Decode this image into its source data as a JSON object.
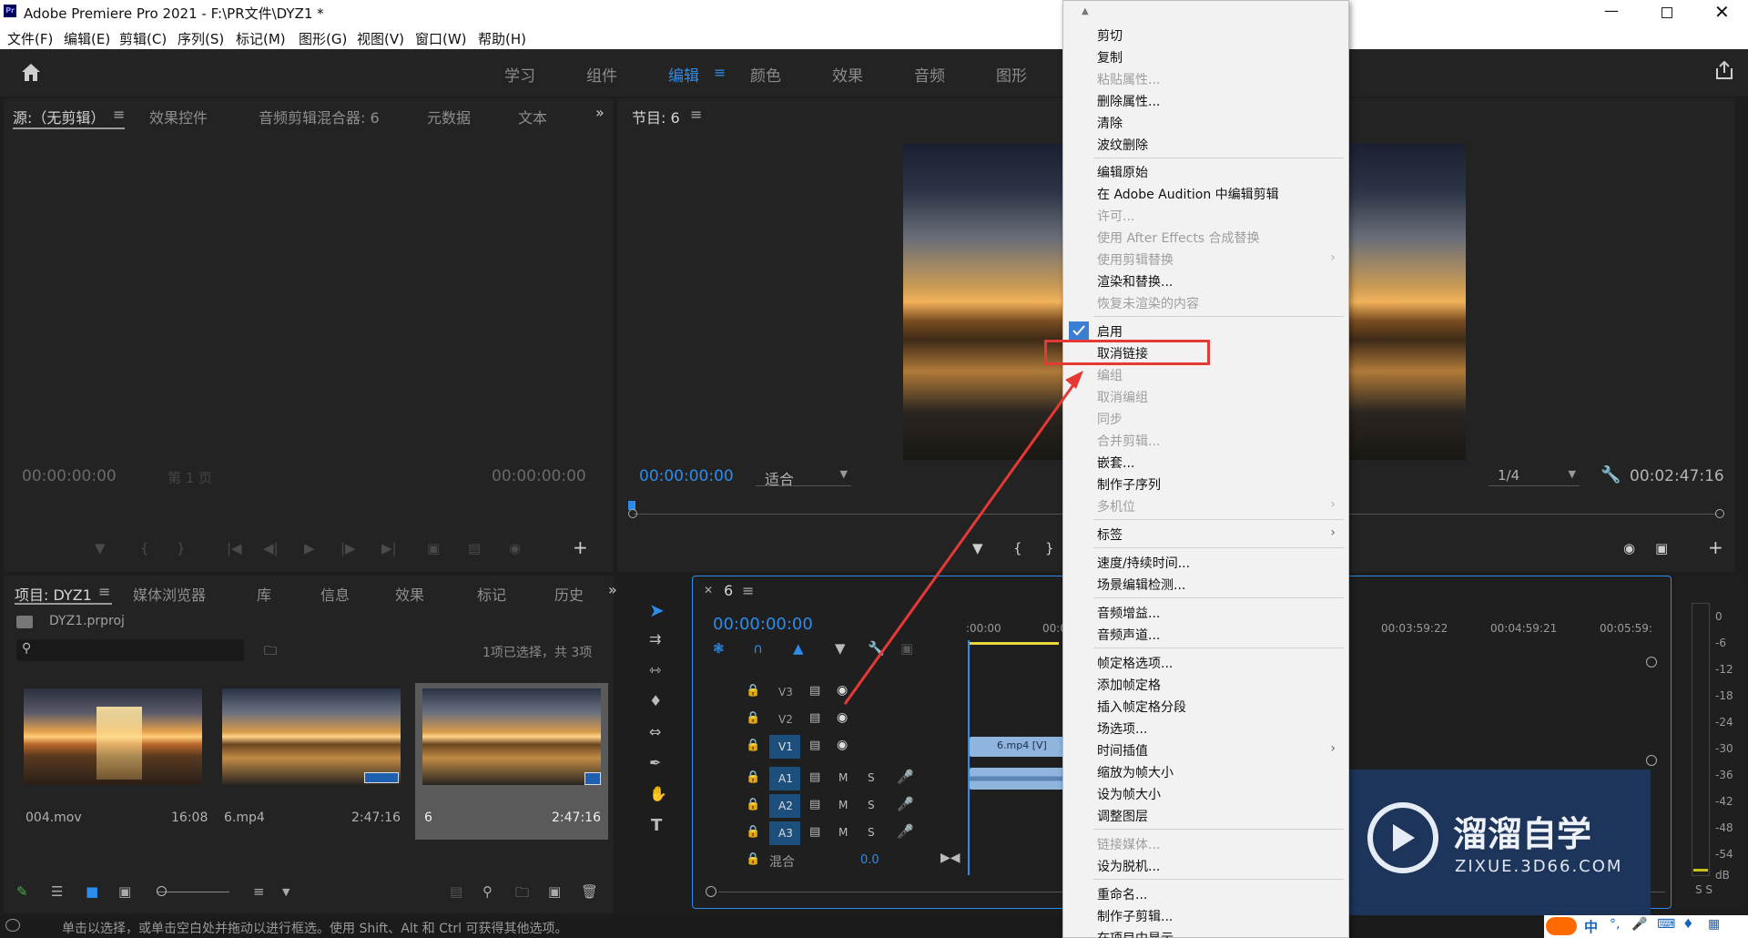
{
  "app": {
    "title": "Adobe Premiere Pro 2021 - F:\\PR文件\\DYZ1 *",
    "logo": "Pr"
  },
  "menubar": [
    "文件(F)",
    "编辑(E)",
    "剪辑(C)",
    "序列(S)",
    "标记(M)",
    "图形(G)",
    "视图(V)",
    "窗口(W)",
    "帮助(H)"
  ],
  "workspaces": [
    "学习",
    "组件",
    "编辑",
    "颜色",
    "效果",
    "音频",
    "图形"
  ],
  "source_panel": {
    "tabs": [
      "源:（无剪辑）",
      "效果控件",
      "音频剪辑混合器: 6",
      "元数据",
      "文本"
    ],
    "timecode_in": "00:00:00:00",
    "timecode_out": "00:00:00:00",
    "page": "第 1 页"
  },
  "program_panel": {
    "tab": "节目: 6",
    "timecode": "00:00:00:00",
    "fit": "适合",
    "resolution": "1/4",
    "duration": "00:02:47:16"
  },
  "project_panel": {
    "tabs": [
      "项目: DYZ1",
      "媒体浏览器",
      "库",
      "信息",
      "效果",
      "标记",
      "历史"
    ],
    "project_file": "DYZ1.prproj",
    "selection_info": "1项已选择，共 3项",
    "search_placeholder": "",
    "clips": [
      {
        "name": "004.mov",
        "duration": "16:08"
      },
      {
        "name": "6.mp4",
        "duration": "2:47:16"
      },
      {
        "name": "6",
        "duration": "2:47:16"
      }
    ]
  },
  "timeline": {
    "sequence": "6",
    "timecode": "00:00:00:00",
    "ruler": [
      ":00:00",
      "00:0",
      "00:03:59:22",
      "00:04:59:21",
      "00:05:59:"
    ],
    "tracks": [
      "V3",
      "V2",
      "V1",
      "A1",
      "A2",
      "A3"
    ],
    "mix_label": "混合",
    "mix_value": "0.0",
    "clip_video_label": "6.mp4 [V]"
  },
  "meter": {
    "scale": [
      "0",
      "-6",
      "-12",
      "-18",
      "-24",
      "-30",
      "-36",
      "-42",
      "-48",
      "-54",
      "dB"
    ],
    "solo": "S S"
  },
  "context_menu": {
    "items": [
      {
        "label": "剪切",
        "disabled": false
      },
      {
        "label": "复制",
        "disabled": false
      },
      {
        "label": "粘贴属性...",
        "disabled": true
      },
      {
        "label": "删除属性...",
        "disabled": false
      },
      {
        "label": "清除",
        "disabled": false
      },
      {
        "label": "波纹删除",
        "disabled": false
      },
      {
        "label": "编辑原始",
        "disabled": false
      },
      {
        "label": "在 Adobe Audition 中编辑剪辑",
        "disabled": false
      },
      {
        "label": "许可...",
        "disabled": true
      },
      {
        "label": "使用 After Effects 合成替换",
        "disabled": true
      },
      {
        "label": "使用剪辑替换",
        "disabled": true,
        "submenu": true
      },
      {
        "label": "渲染和替换...",
        "disabled": false
      },
      {
        "label": "恢复未渲染的内容",
        "disabled": true
      },
      {
        "label": "启用",
        "disabled": false,
        "checked": true
      },
      {
        "label": "取消链接",
        "disabled": false,
        "highlighted": true
      },
      {
        "label": "编组",
        "disabled": true
      },
      {
        "label": "取消编组",
        "disabled": true
      },
      {
        "label": "同步",
        "disabled": true
      },
      {
        "label": "合并剪辑...",
        "disabled": true
      },
      {
        "label": "嵌套...",
        "disabled": false
      },
      {
        "label": "制作子序列",
        "disabled": false
      },
      {
        "label": "多机位",
        "disabled": true,
        "submenu": true
      },
      {
        "label": "标签",
        "disabled": false,
        "submenu": true
      },
      {
        "label": "速度/持续时间...",
        "disabled": false
      },
      {
        "label": "场景编辑检测...",
        "disabled": false
      },
      {
        "label": "音频增益...",
        "disabled": false
      },
      {
        "label": "音频声道...",
        "disabled": false
      },
      {
        "label": "帧定格选项...",
        "disabled": false
      },
      {
        "label": "添加帧定格",
        "disabled": false
      },
      {
        "label": "插入帧定格分段",
        "disabled": false
      },
      {
        "label": "场选项...",
        "disabled": false
      },
      {
        "label": "时间插值",
        "disabled": false,
        "submenu": true
      },
      {
        "label": "缩放为帧大小",
        "disabled": false
      },
      {
        "label": "设为帧大小",
        "disabled": false
      },
      {
        "label": "调整图层",
        "disabled": false
      },
      {
        "label": "链接媒体...",
        "disabled": true
      },
      {
        "label": "设为脱机...",
        "disabled": false
      },
      {
        "label": "重命名...",
        "disabled": false
      },
      {
        "label": "制作子剪辑...",
        "disabled": false
      },
      {
        "label": "在项目中显示",
        "disabled": false
      }
    ]
  },
  "watermark": {
    "brand": "溜溜自学",
    "url": "ZIXUE.3D66.COM"
  },
  "status": {
    "hint": "单击以选择，或单击空白处并拖动以进行框选。使用 Shift、Alt 和 Ctrl 可获得其他选项。",
    "ime": "中"
  },
  "colors": {
    "accent": "#2d8ceb",
    "highlight_box": "#e53935",
    "panel": "#232323",
    "bg": "#1d1d1d"
  }
}
